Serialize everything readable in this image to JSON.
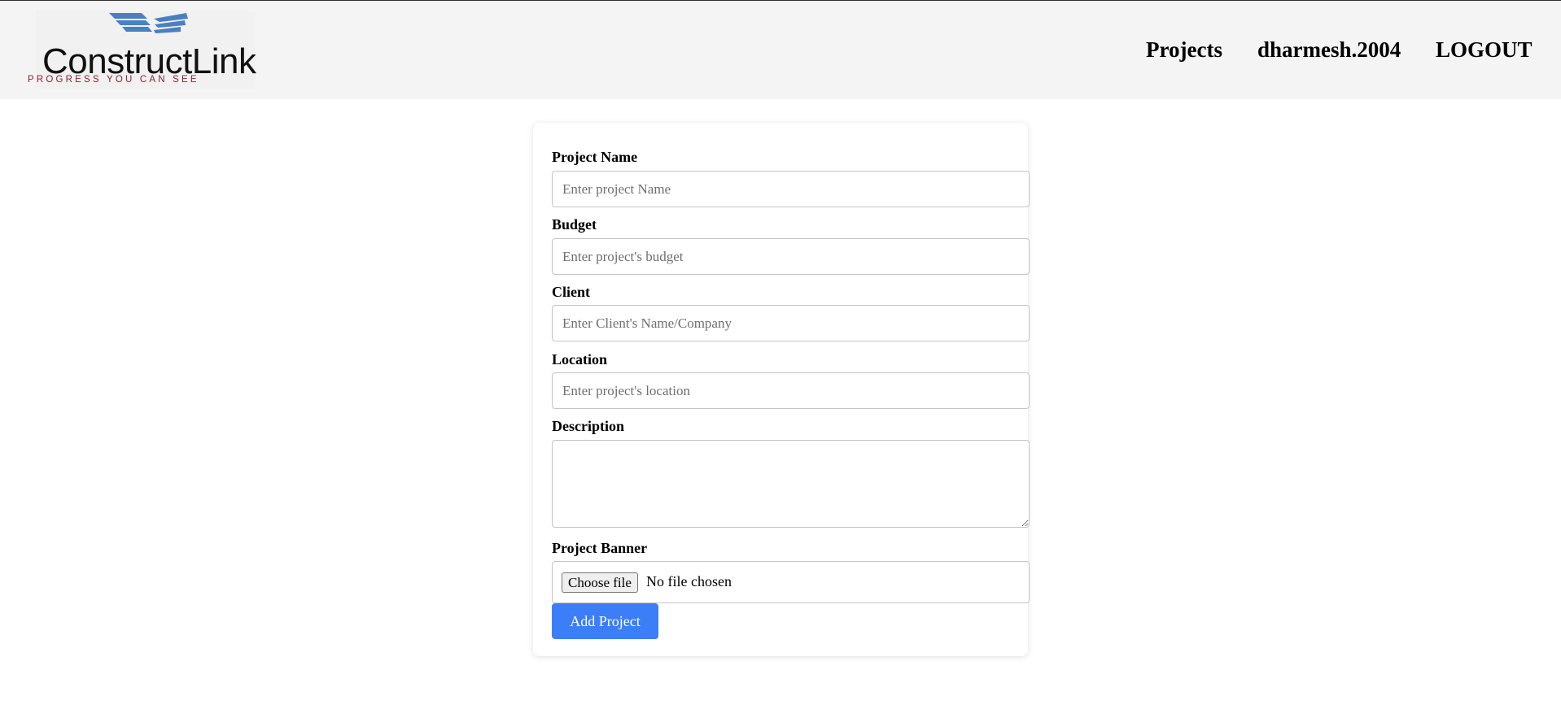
{
  "header": {
    "logo": {
      "wordmark": "ConstructLink",
      "tagline": "PROGRESS YOU CAN SEE",
      "colors": {
        "wings": "#4a7fc1",
        "wordmark": "#111111",
        "tagline": "#8a2030"
      }
    },
    "nav": {
      "projects": "Projects",
      "user": "dharmesh.2004",
      "logout": "LOGOUT"
    }
  },
  "form": {
    "project_name": {
      "label": "Project Name",
      "placeholder": "Enter project Name",
      "value": ""
    },
    "budget": {
      "label": "Budget",
      "placeholder": "Enter project's budget",
      "value": ""
    },
    "client": {
      "label": "Client",
      "placeholder": "Enter Client's Name/Company",
      "value": ""
    },
    "location": {
      "label": "Location",
      "placeholder": "Enter project's location",
      "value": ""
    },
    "description": {
      "label": "Description",
      "value": ""
    },
    "banner": {
      "label": "Project Banner",
      "button": "Choose file",
      "status": "No file chosen"
    },
    "submit_label": "Add Project"
  },
  "colors": {
    "header_bg": "#f4f4f4",
    "primary_button": "#3b7ef8"
  }
}
